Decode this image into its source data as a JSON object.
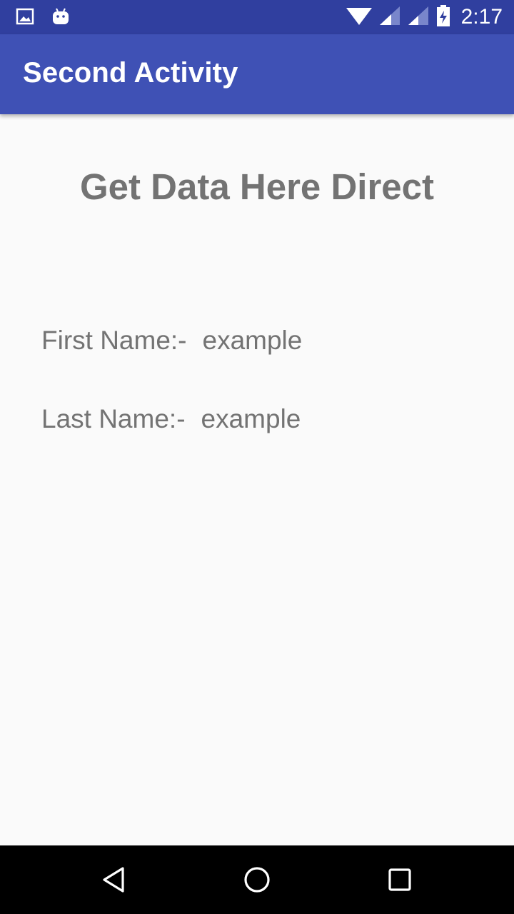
{
  "status_bar": {
    "time": "2:17",
    "icons": [
      "image-notification-icon",
      "android-notification-icon",
      "wifi-icon",
      "signal-icon",
      "signal-icon-2",
      "battery-icon"
    ],
    "background": "#303f9f"
  },
  "app_bar": {
    "title": "Second Activity",
    "background": "#3f51b5"
  },
  "main": {
    "heading": "Get Data Here Direct",
    "first_name_label": "First Name:-",
    "first_name_value": "example",
    "last_name_label": "Last Name:-",
    "last_name_value": "example",
    "text_color": "#737373"
  },
  "nav_bar": {
    "buttons": [
      "back-icon",
      "home-icon",
      "recents-icon"
    ]
  }
}
